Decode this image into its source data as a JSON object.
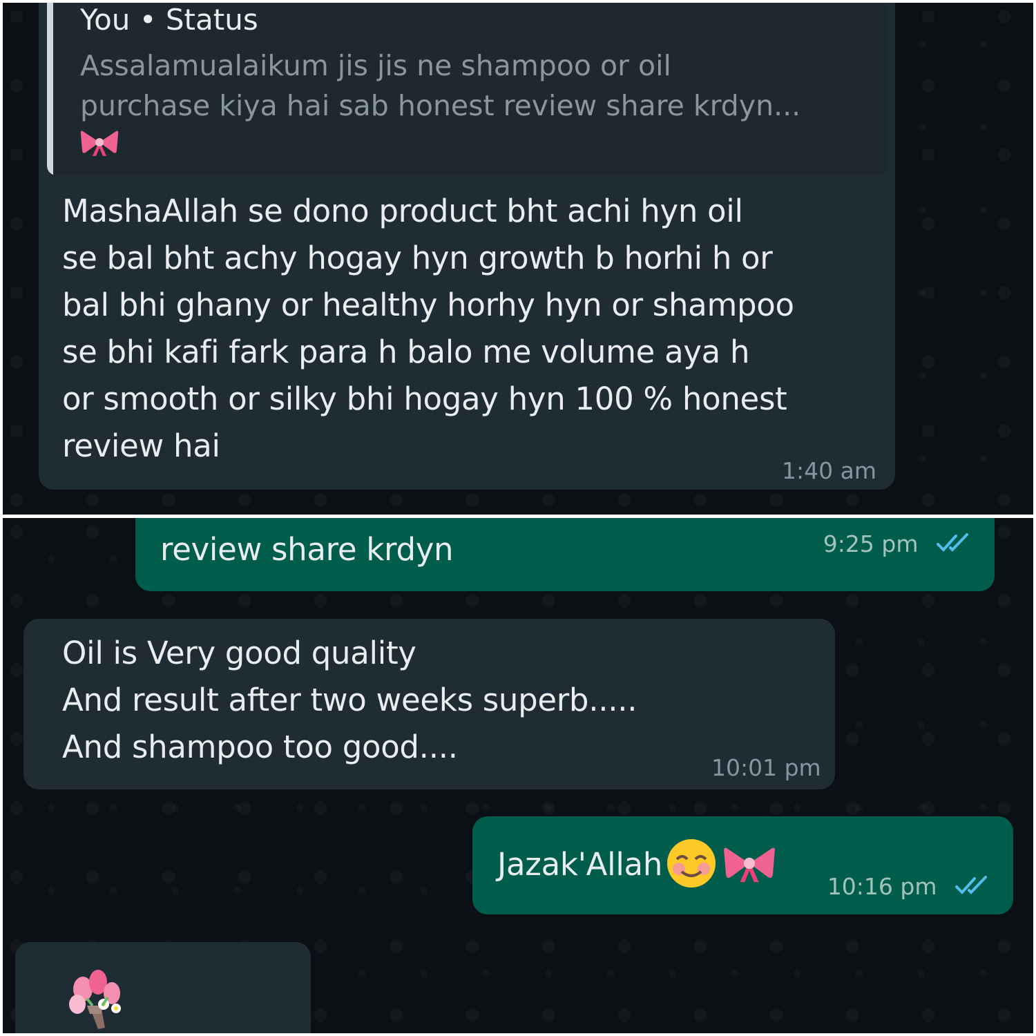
{
  "top_panel": {
    "quote": {
      "author": "You • Status",
      "text": "Assalamualaikum jis jis ne shampoo or oil\npurchase kiya hai sab honest review share krdyn...",
      "emoji": "ribbon-emoji"
    },
    "reply": {
      "text": "MashaAllah se dono product bht achi hyn oil\nse bal bht achy hogay hyn growth b horhi h or\nbal bhi ghany or healthy horhy hyn or shampoo\nse bhi kafi fark para h balo me volume aya h\nor smooth or silky bhi hogay hyn 100 % honest\nreview hai",
      "time": "1:40 am"
    }
  },
  "bottom_panel": {
    "messages": [
      {
        "direction": "out",
        "text": "review share krdyn",
        "time": "9:25 pm",
        "status": "read"
      },
      {
        "direction": "in",
        "text": "Oil is Very good quality\nAnd result after two weeks superb.....\nAnd shampoo too good....",
        "time": "10:01 pm"
      },
      {
        "direction": "out",
        "text": "Jazak'Allah",
        "emojis": [
          "smiling-face-emoji",
          "ribbon-emoji"
        ],
        "time": "10:16 pm",
        "status": "read"
      },
      {
        "direction": "in",
        "emojis": [
          "bouquet-emoji"
        ]
      }
    ]
  },
  "colors": {
    "chat_background": "#0b1014",
    "incoming_bubble": "#202c33",
    "outgoing_bubble": "#005c4b",
    "read_ticks": "#53bdeb",
    "meta_text": "#8696a0"
  }
}
